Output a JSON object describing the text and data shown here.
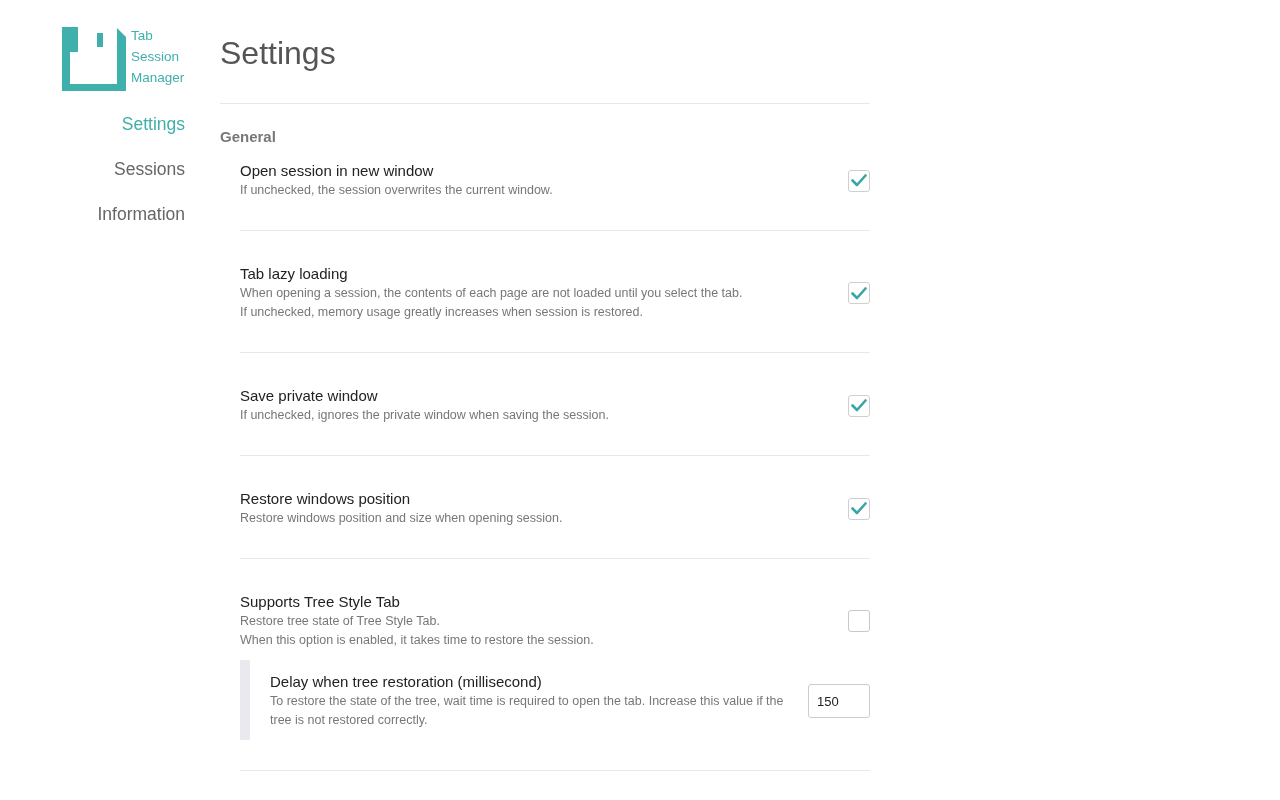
{
  "sidebar": {
    "app_name": "Tab Session Manager",
    "nav": [
      {
        "label": "Settings",
        "selected": true
      },
      {
        "label": "Sessions",
        "selected": false
      },
      {
        "label": "Information",
        "selected": false
      }
    ]
  },
  "page": {
    "title": "Settings"
  },
  "sections": [
    {
      "heading": "General",
      "options": [
        {
          "kind": "checkbox",
          "title": "Open session in new window",
          "description": [
            "If unchecked, the session overwrites the current window."
          ],
          "checked": true
        },
        {
          "kind": "checkbox",
          "title": "Tab lazy loading",
          "description": [
            "When opening a session, the contents of each page are not loaded until you select the tab.",
            "If unchecked, memory usage greatly increases when session is restored."
          ],
          "checked": true
        },
        {
          "kind": "checkbox",
          "title": "Save private window",
          "description": [
            "If unchecked, ignores the private window when saving the session."
          ],
          "checked": true
        },
        {
          "kind": "checkbox",
          "title": "Restore windows position",
          "description": [
            "Restore windows position and size when opening session."
          ],
          "checked": true
        },
        {
          "kind": "checkbox",
          "title": "Supports Tree Style Tab",
          "description": [
            "Restore tree state of Tree Style Tab.",
            "When this option is enabled, it takes time to restore the session."
          ],
          "checked": false,
          "children": [
            {
              "kind": "number",
              "title": "Delay when tree restoration (millisecond)",
              "description": [
                "To restore the state of the tree, wait time is required to open the tab. Increase this value if the tree is not restored correctly."
              ],
              "value": "150"
            }
          ]
        }
      ]
    }
  ]
}
